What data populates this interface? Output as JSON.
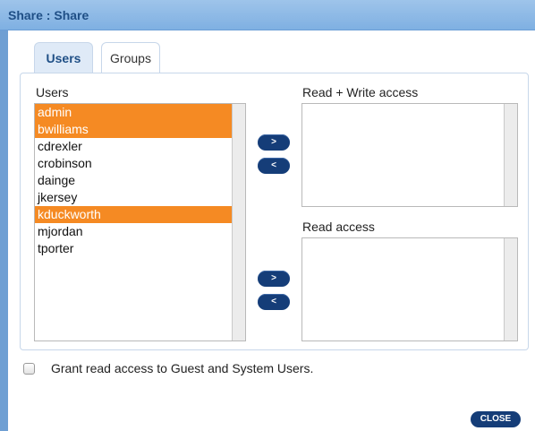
{
  "window": {
    "title": "Share : Share"
  },
  "tabs": [
    {
      "label": "Users",
      "active": true
    },
    {
      "label": "Groups",
      "active": false
    }
  ],
  "users_list": {
    "label": "Users",
    "items": [
      {
        "name": "admin",
        "selected": true
      },
      {
        "name": "bwilliams",
        "selected": true
      },
      {
        "name": "cdrexler",
        "selected": false
      },
      {
        "name": "crobinson",
        "selected": false
      },
      {
        "name": "dainge",
        "selected": false
      },
      {
        "name": "jkersey",
        "selected": false
      },
      {
        "name": "kduckworth",
        "selected": true
      },
      {
        "name": "mjordan",
        "selected": false
      },
      {
        "name": "tporter",
        "selected": false
      }
    ]
  },
  "read_write": {
    "label": "Read + Write access",
    "items": []
  },
  "read_only": {
    "label": "Read access",
    "items": []
  },
  "buttons": {
    "add_rw": ">",
    "remove_rw": "<",
    "add_r": ">",
    "remove_r": "<",
    "close": "CLOSE"
  },
  "guest_checkbox": {
    "label": "Grant read access to Guest and System Users.",
    "checked": false
  },
  "colors": {
    "selected": "#f58a23",
    "button": "#153d78",
    "title_text": "#1f4f86"
  }
}
